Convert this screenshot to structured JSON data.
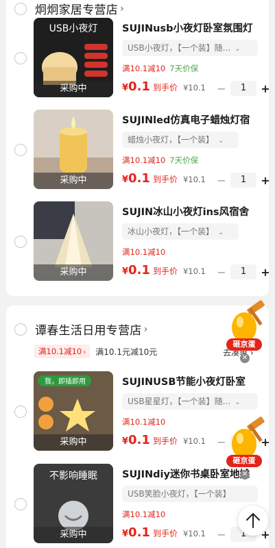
{
  "stores": [
    {
      "name": "炯炯家居专营店",
      "items": [
        {
          "title": "SUJINusb小夜灯卧室氛围灯",
          "spec": "USB小夜灯，【一个装】随...",
          "promo": "满10.1减10",
          "promo_extra": "7天价保",
          "price_currency": "¥",
          "price_value": "0.1",
          "price_hint": "到手价",
          "orig": "¥10.1",
          "qty": "1",
          "badge": "采购中",
          "thumb_text": "USB小夜灯"
        },
        {
          "title": "SUJINled仿真电子蜡烛灯宿",
          "spec": "蜡烛小夜灯，【一个装】",
          "promo": "满10.1减10",
          "promo_extra": "7天价保",
          "price_currency": "¥",
          "price_value": "0.1",
          "price_hint": "到手价",
          "orig": "¥10.1",
          "qty": "1",
          "badge": "采购中"
        },
        {
          "title": "SUJIN冰山小夜灯ins风宿舍",
          "spec": "冰山小夜灯，【一个装】",
          "promo": "满10.1减10",
          "promo_extra": "",
          "price_currency": "¥",
          "price_value": "0.1",
          "price_hint": "到手价",
          "orig": "¥10.1",
          "qty": "1",
          "badge": "采购中"
        }
      ]
    },
    {
      "name": "谭春生活日用专营店",
      "coupon_tag": "满10.1减10",
      "coupon_text": "满10.1元减10元",
      "coupon_right": "去凑单",
      "items": [
        {
          "title": "SUJINUSB节能小夜灯卧室",
          "spec": "USB星星灯，【一个装】随...",
          "promo": "满10.1减10",
          "promo_extra": "",
          "price_currency": "¥",
          "price_value": "0.1",
          "price_hint": "到手价",
          "orig": "¥10.1",
          "qty": "1",
          "badge": "采购中",
          "thumb_text": "我，即插即用"
        },
        {
          "title": "SUJINdiy迷你书桌卧室地摊",
          "spec": "USB笑脸小夜灯，【一个装】",
          "promo": "满10.1减10",
          "promo_extra": "",
          "price_currency": "¥",
          "price_value": "0.1",
          "price_hint": "到手价",
          "orig": "¥10.1",
          "qty": "1",
          "badge": "采购中",
          "thumb_text": "不影响睡眠"
        }
      ]
    }
  ],
  "egg_label": "砸京蛋",
  "colors": {
    "accent": "#e1251b",
    "green": "#48a84a"
  }
}
